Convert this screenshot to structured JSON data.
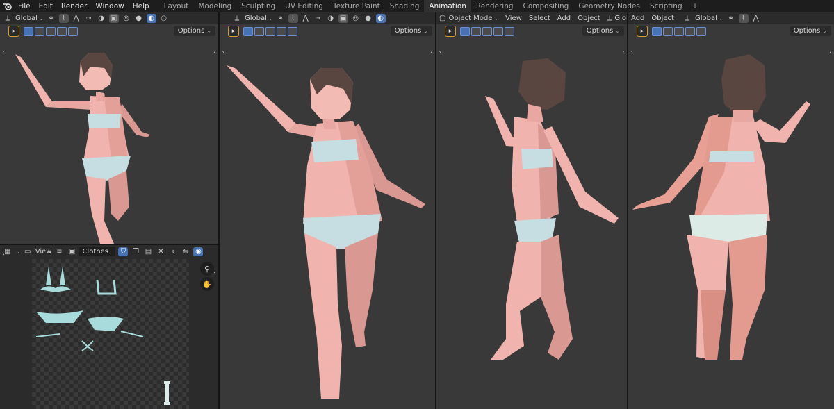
{
  "topbar": {
    "menus": [
      "File",
      "Edit",
      "Render",
      "Window",
      "Help"
    ],
    "workspaces": [
      "Layout",
      "Modeling",
      "Sculpting",
      "UV Editing",
      "Texture Paint",
      "Shading",
      "Animation",
      "Rendering",
      "Compositing",
      "Geometry Nodes",
      "Scripting"
    ],
    "active_workspace": "Animation",
    "add_tab": "+"
  },
  "viewport1": {
    "orientation": "Global",
    "options": "Options"
  },
  "viewport2": {
    "orientation": "Global",
    "options": "Options"
  },
  "viewport3": {
    "mode": "Object Mode",
    "menus": [
      "View",
      "Select",
      "Add",
      "Object"
    ],
    "orientation": "Global",
    "options": "Options"
  },
  "viewport4": {
    "menus": [
      "Add",
      "Object"
    ],
    "orientation": "Global",
    "options": "Options"
  },
  "image_editor": {
    "view_menu": "View",
    "image_name": "Clothes"
  },
  "colors": {
    "skin": "#f0b3ad",
    "skin_shade": "#d99891",
    "hair": "#5a4640",
    "cloth": "#bfdbe0",
    "uv": "#a8dcdc",
    "accent": "#4772b3",
    "tool_outline": "#d89a2a"
  }
}
